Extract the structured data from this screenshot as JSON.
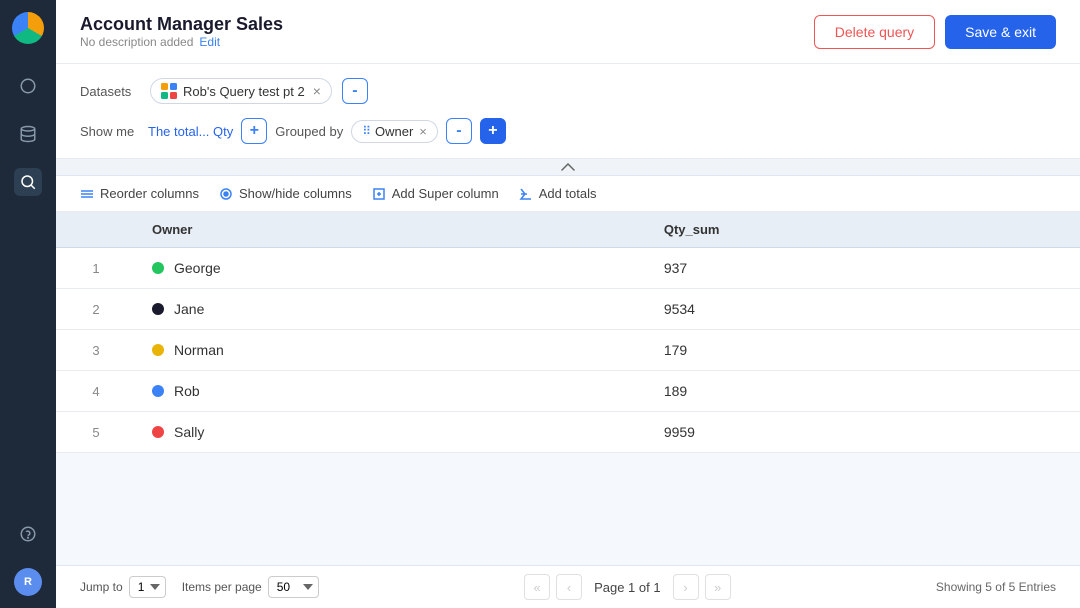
{
  "app": {
    "logo_alt": "App logo"
  },
  "sidebar": {
    "items": [
      {
        "name": "circle-icon",
        "label": "Circle",
        "active": false
      },
      {
        "name": "database-icon",
        "label": "Database",
        "active": false
      },
      {
        "name": "search-icon",
        "label": "Search",
        "active": true
      },
      {
        "name": "question-icon",
        "label": "Help",
        "active": false
      }
    ]
  },
  "header": {
    "title": "Account Manager Sales",
    "subtitle": "No description added",
    "edit_label": "Edit",
    "delete_label": "Delete query",
    "save_label": "Save & exit"
  },
  "datasets": {
    "label": "Datasets",
    "chips": [
      {
        "name": "Rob's Query test pt 2"
      }
    ],
    "add_label": "-",
    "add_plus_label": "+"
  },
  "showme": {
    "label": "Show me",
    "metric": "The total... Qty",
    "add_label": "+",
    "grouped_by_label": "Grouped by",
    "group_chips": [
      {
        "name": "Owner"
      }
    ],
    "minus_label": "-",
    "plus_label": "+"
  },
  "table_toolbar": {
    "reorder_label": "Reorder columns",
    "showhide_label": "Show/hide columns",
    "super_label": "Add Super column",
    "totals_label": "Add totals"
  },
  "table": {
    "columns": [
      "",
      "Owner",
      "Qty_sum"
    ],
    "rows": [
      {
        "row_num": "1",
        "owner": "George",
        "dot_color": "#22c55e",
        "qty_sum": "937"
      },
      {
        "row_num": "2",
        "owner": "Jane",
        "dot_color": "#1a1a2e",
        "qty_sum": "9534"
      },
      {
        "row_num": "3",
        "owner": "Norman",
        "dot_color": "#eab308",
        "qty_sum": "179"
      },
      {
        "row_num": "4",
        "owner": "Rob",
        "dot_color": "#3b82f6",
        "qty_sum": "189"
      },
      {
        "row_num": "5",
        "owner": "Sally",
        "dot_color": "#ef4444",
        "qty_sum": "9959"
      }
    ]
  },
  "footer": {
    "jump_to_label": "Jump to",
    "jump_to_value": "1",
    "items_per_page_label": "Items per page",
    "items_per_page_value": "50",
    "page_label": "Page 1 of 1",
    "showing_label": "Showing 5 of 5 Entries"
  }
}
